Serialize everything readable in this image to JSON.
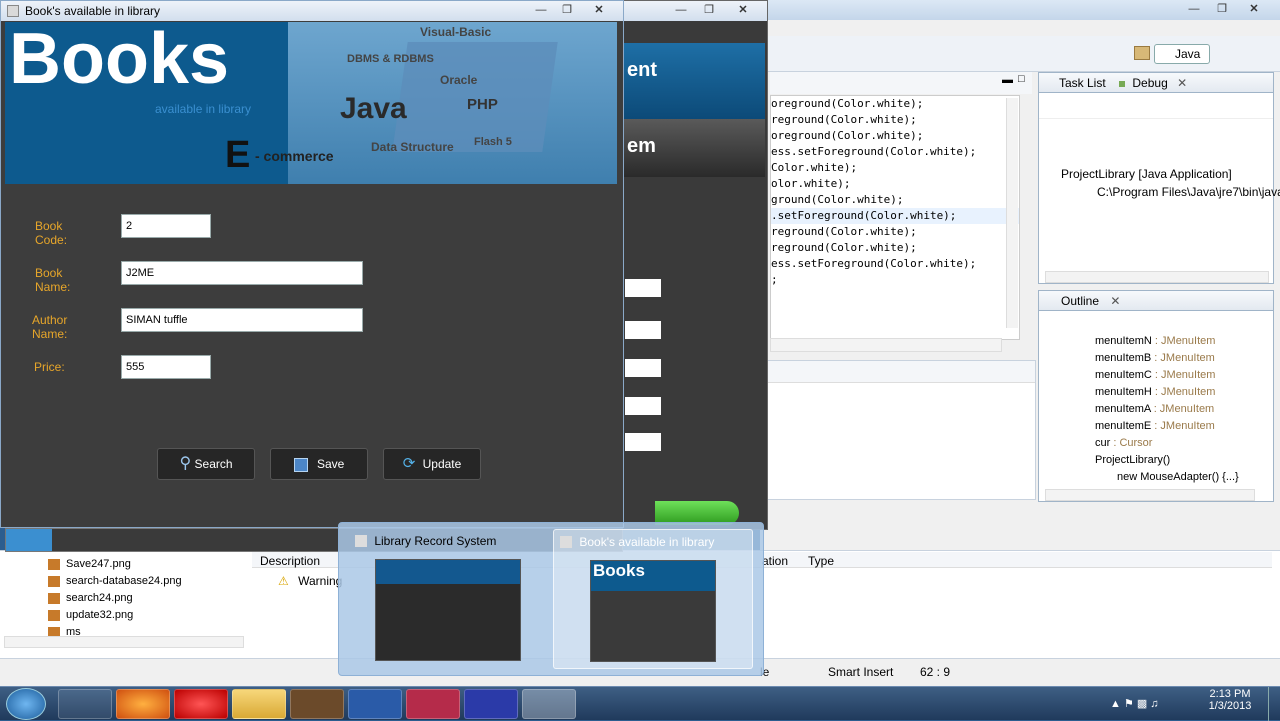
{
  "books_window": {
    "title": "Book's available in library",
    "banner": {
      "brand": "Books",
      "tagline": "available in library",
      "words": [
        "Visual-Basic",
        "DBMS & RDBMS",
        "Oracle",
        "Java",
        "PHP",
        "Flash 5",
        "Data Structure",
        "E",
        "- commerce"
      ]
    },
    "fields": [
      {
        "label": "Book Code:",
        "value": "2"
      },
      {
        "label": "Book Name:",
        "value": "J2ME"
      },
      {
        "label": "Author Name:",
        "value": "SIMAN tuffle"
      },
      {
        "label": "Price:",
        "value": "555"
      }
    ],
    "buttons": {
      "search": "Search",
      "save": "Save",
      "update": "Update"
    }
  },
  "library_window": {
    "banner_fragments": [
      "ent",
      "em"
    ]
  },
  "eclipse": {
    "perspective": "Java",
    "code_lines": [
      "oreground(Color.white);",
      "reground(Color.white);",
      "oreground(Color.white);",
      "ess.setForeground(Color.white);",
      "Color.white);",
      "olor.white);",
      "ground(Color.white);",
      "",
      ".setForeground(Color.white);",
      "reground(Color.white);",
      "reground(Color.white);",
      "ess.setForeground(Color.white);",
      ";"
    ],
    "tasklist_tab": "Task List",
    "debug_tab": "Debug",
    "debug_items": [
      "ProjectLibrary [Java Application]",
      "C:\\Program Files\\Java\\jre7\\bin\\java"
    ],
    "outline_tab": "Outline",
    "outline_items": [
      {
        "name": "menuItemN",
        "type": " : JMenuItem"
      },
      {
        "name": "menuItemB",
        "type": " : JMenuItem"
      },
      {
        "name": "menuItemC",
        "type": " : JMenuItem"
      },
      {
        "name": "menuItemH",
        "type": " : JMenuItem"
      },
      {
        "name": "menuItemA",
        "type": " : JMenuItem"
      },
      {
        "name": "menuItemE",
        "type": " : JMenuItem"
      },
      {
        "name": "cur",
        "type": " : Cursor"
      },
      {
        "name": "ProjectLibrary()",
        "type": ""
      },
      {
        "name": "new MouseAdapter() {...}",
        "type": ""
      }
    ],
    "problems_cols": [
      "Description",
      "ation",
      "Type"
    ],
    "warning": "Warning",
    "files": [
      "Save247.png",
      "search-database24.png",
      "search24.png",
      "update32.png",
      "ms"
    ],
    "status_insert": "Smart Insert",
    "status_pos": "62 : 9",
    "status_frag": "le"
  },
  "thumbnails": [
    {
      "title": "Library Record System"
    },
    {
      "title": "Book's available in library",
      "brand": "Books"
    }
  ],
  "taskbar": {
    "time": "2:13 PM",
    "date": "1/3/2013",
    "apps": [
      "start",
      "internet-explorer",
      "firefox",
      "opera",
      "explorer",
      "java-ee",
      "word",
      "access",
      "app-blue",
      "java"
    ]
  }
}
